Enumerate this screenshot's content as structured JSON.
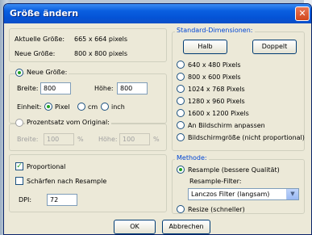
{
  "window": {
    "title": "Größe ändern"
  },
  "current": {
    "aktuelle_label": "Aktuelle Größe:",
    "aktuelle_value": "665 x 664 pixels",
    "neue_label": "Neue Größe:",
    "neue_value": "800 x 800 pixels"
  },
  "new_size": {
    "label": "Neue Größe:",
    "breite_label": "Breite:",
    "breite_value": "800",
    "hoehe_label": "Höhe:",
    "hoehe_value": "800",
    "einheit_label": "Einheit:",
    "units": [
      "Pixel",
      "cm",
      "inch"
    ],
    "selected_unit": "Pixel"
  },
  "percent": {
    "label": "Prozentsatz vom Original:",
    "breite_label": "Breite:",
    "breite_value": "100",
    "breite_unit": "%",
    "hoehe_label": "Höhe:",
    "hoehe_value": "100",
    "hoehe_unit": "%"
  },
  "options": {
    "proportional_label": "Proportional",
    "proportional_checked": true,
    "sharpen_label": "Schärfen nach Resample",
    "sharpen_checked": false,
    "dpi_label": "DPI:",
    "dpi_value": "72"
  },
  "standard": {
    "label": "Standard-Dimensionen:",
    "halb_label": "Halb",
    "doppelt_label": "Doppelt",
    "items": [
      "640 x 480 Pixels",
      "800 x 600 Pixels",
      "1024 x 768 Pixels",
      "1280 x 960 Pixels",
      "1600 x 1200 Pixels",
      "An Bildschirm anpassen",
      "Bildschirmgröße (nicht proportional)"
    ]
  },
  "method": {
    "label": "Methode:",
    "resample_label": "Resample (bessere Qualität)",
    "filter_label": "Resample-Filter:",
    "filter_value": "Lanczos Filter (langsam)",
    "resize_label": "Resize (schneller)"
  },
  "buttons": {
    "ok": "OK",
    "cancel": "Abbrechen"
  }
}
